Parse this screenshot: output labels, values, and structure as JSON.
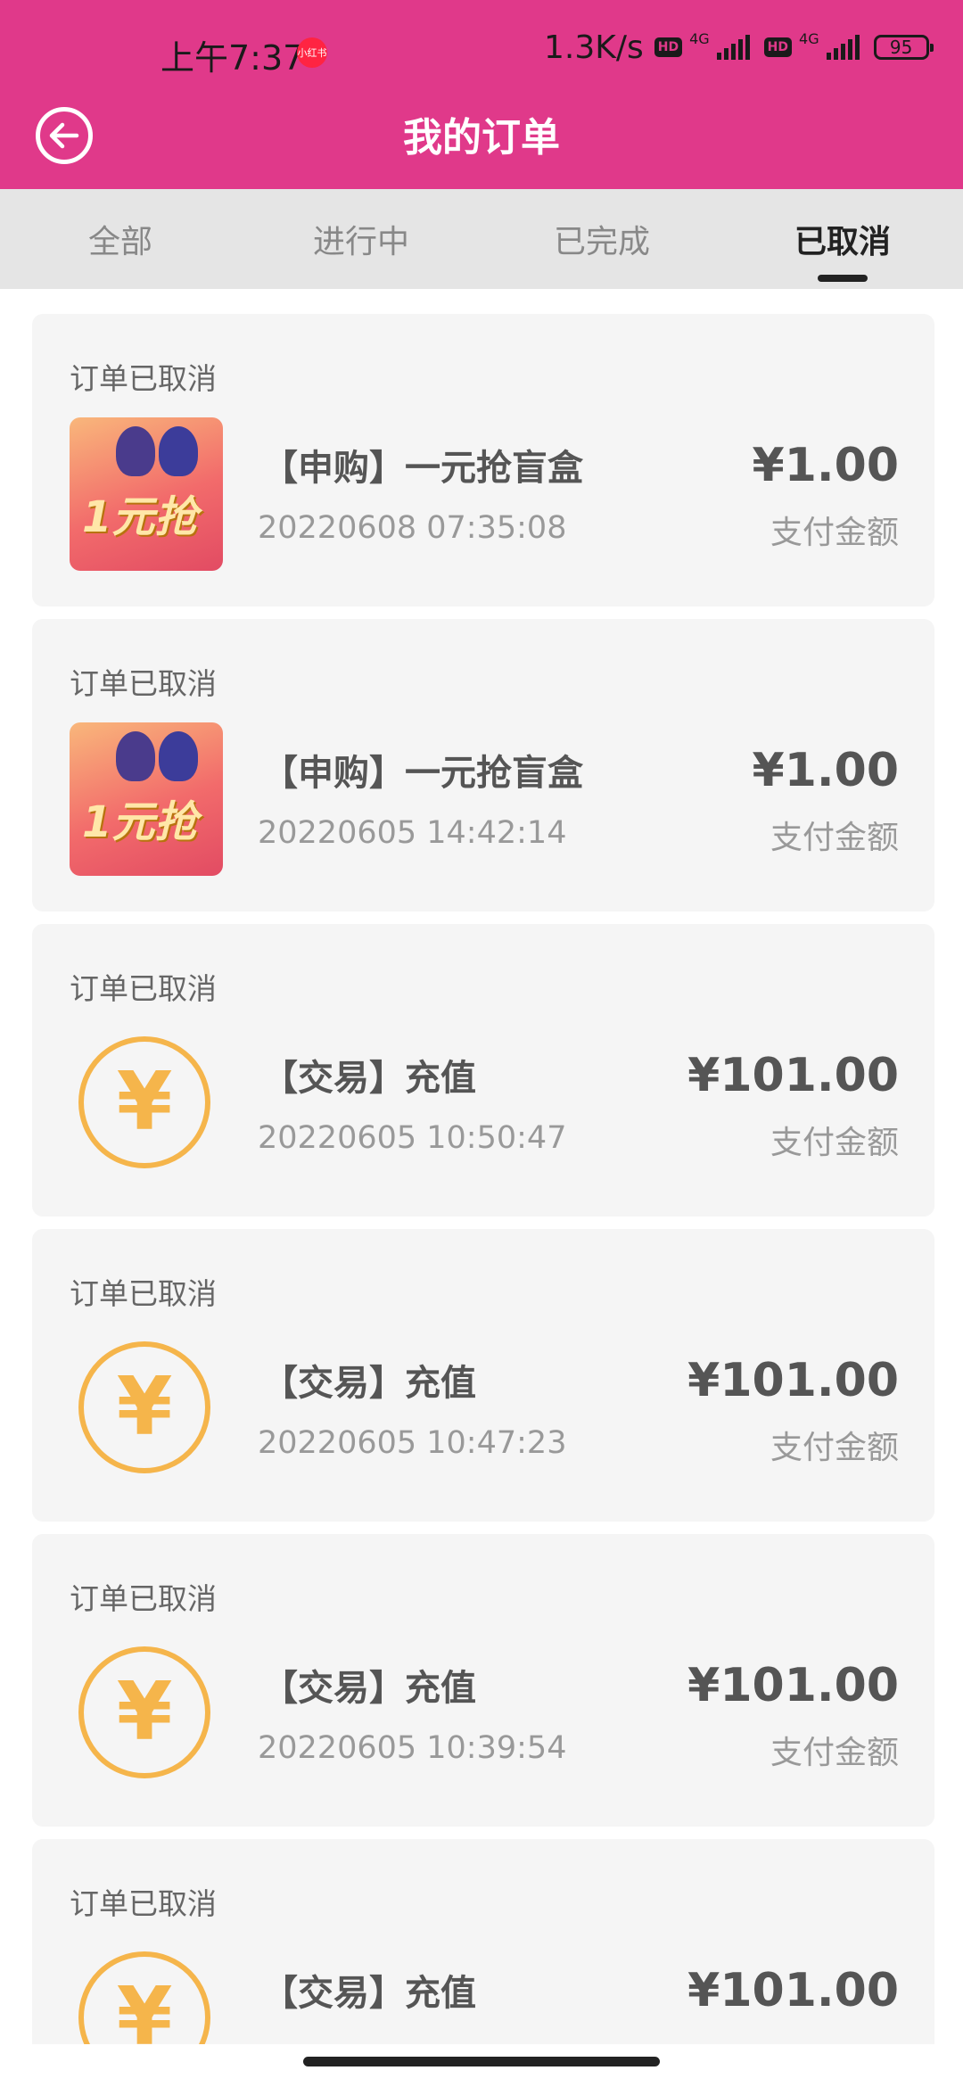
{
  "status_bar": {
    "time": "上午7:37",
    "app_badge": "小红书",
    "net_speed": "1.3K/s",
    "hd": "HD",
    "net_type": "4G",
    "battery": "95"
  },
  "header": {
    "title": "我的订单",
    "back_icon": "back-arrow-circle-icon",
    "bg_color": "#E0398A"
  },
  "tabs": [
    {
      "label": "全部",
      "active": false
    },
    {
      "label": "进行中",
      "active": false
    },
    {
      "label": "已完成",
      "active": false
    },
    {
      "label": "已取消",
      "active": true
    }
  ],
  "orders": [
    {
      "status": "订单已取消",
      "icon": "blind-box-thumbnail",
      "thumb_text": "1元抢",
      "title": "【申购】一元抢盲盒",
      "time": "20220608 07:35:08",
      "amount": "¥1.00",
      "amount_label": "支付金额"
    },
    {
      "status": "订单已取消",
      "icon": "blind-box-thumbnail",
      "thumb_text": "1元抢",
      "title": "【申购】一元抢盲盒",
      "time": "20220605 14:42:14",
      "amount": "¥1.00",
      "amount_label": "支付金额"
    },
    {
      "status": "订单已取消",
      "icon": "yen-coin-icon",
      "coin_symbol": "¥",
      "title": "【交易】充值",
      "time": "20220605 10:50:47",
      "amount": "¥101.00",
      "amount_label": "支付金额"
    },
    {
      "status": "订单已取消",
      "icon": "yen-coin-icon",
      "coin_symbol": "¥",
      "title": "【交易】充值",
      "time": "20220605 10:47:23",
      "amount": "¥101.00",
      "amount_label": "支付金额"
    },
    {
      "status": "订单已取消",
      "icon": "yen-coin-icon",
      "coin_symbol": "¥",
      "title": "【交易】充值",
      "time": "20220605 10:39:54",
      "amount": "¥101.00",
      "amount_label": "支付金额"
    },
    {
      "status": "订单已取消",
      "icon": "yen-coin-icon",
      "coin_symbol": "¥",
      "title": "【交易】充值",
      "time": "",
      "amount": "¥101.00",
      "amount_label": ""
    }
  ],
  "colors": {
    "accent": "#E0398A",
    "coin": "#F5B54B",
    "card_bg": "#F5F5F5",
    "tab_bg": "#E5E5E5"
  }
}
